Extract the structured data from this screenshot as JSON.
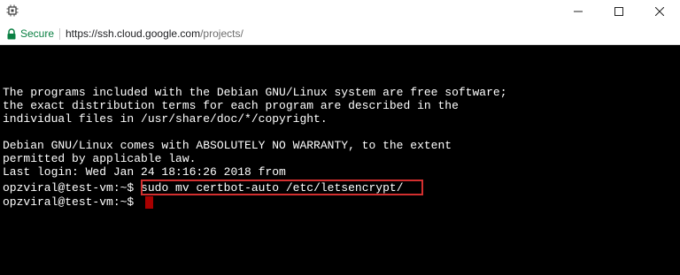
{
  "window": {
    "controls": {
      "minimize": "minimize-icon",
      "maximize": "maximize-icon",
      "close": "close-icon"
    }
  },
  "address_bar": {
    "security_label": "Secure",
    "url_host": "https://ssh.cloud.google.com",
    "url_path": "/projects/",
    "secure_color": "#0b8043"
  },
  "terminal": {
    "lines": [
      "The programs included with the Debian GNU/Linux system are free software;",
      "the exact distribution terms for each program are described in the",
      "individual files in /usr/share/doc/*/copyright.",
      "",
      "Debian GNU/Linux comes with ABSOLUTELY NO WARRANTY, to the extent",
      "permitted by applicable law.",
      "Last login: Wed Jan 24 18:16:26 2018 from"
    ],
    "prompt": "opzviral@test-vm:~$",
    "command": "sudo mv certbot-auto /etc/letsencrypt/",
    "highlight_color": "#d32f2f",
    "background": "#000000",
    "foreground": "#ffffff"
  }
}
